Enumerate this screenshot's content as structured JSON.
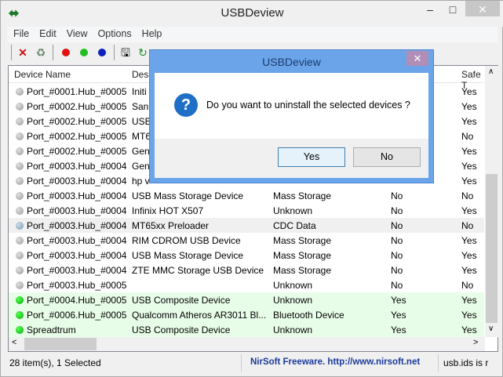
{
  "window": {
    "title": "USBDeview",
    "minimize": "–",
    "maximize": "□",
    "close": "✕"
  },
  "menu": [
    "File",
    "Edit",
    "View",
    "Options",
    "Help"
  ],
  "columns": [
    "Device Name",
    "Desc",
    "",
    "",
    "Safe T"
  ],
  "rows": [
    {
      "name": "Port_#0001.Hub_#0005",
      "desc": "Initi",
      "type": "",
      "connected": "",
      "safe": "Yes",
      "state": "off"
    },
    {
      "name": "Port_#0002.Hub_#0005",
      "desc": "SanD",
      "type": "",
      "connected": "",
      "safe": "Yes",
      "state": "off"
    },
    {
      "name": "Port_#0002.Hub_#0005",
      "desc": "USB",
      "type": "",
      "connected": "",
      "safe": "Yes",
      "state": "off"
    },
    {
      "name": "Port_#0002.Hub_#0005",
      "desc": "MT6",
      "type": "",
      "connected": "",
      "safe": "No",
      "state": "off"
    },
    {
      "name": "Port_#0002.Hub_#0005",
      "desc": "Gen",
      "type": "",
      "connected": "",
      "safe": "Yes",
      "state": "off"
    },
    {
      "name": "Port_#0003.Hub_#0004",
      "desc": "Gen",
      "type": "",
      "connected": "",
      "safe": "Yes",
      "state": "off"
    },
    {
      "name": "Port_#0003.Hub_#0004",
      "desc": "hp v",
      "type": "",
      "connected": "",
      "safe": "Yes",
      "state": "off"
    },
    {
      "name": "Port_#0003.Hub_#0004",
      "desc": "USB Mass Storage Device",
      "type": "Mass Storage",
      "connected": "No",
      "safe": "No",
      "state": "off"
    },
    {
      "name": "Port_#0003.Hub_#0004",
      "desc": "Infinix HOT X507",
      "type": "Unknown",
      "connected": "No",
      "safe": "Yes",
      "state": "off"
    },
    {
      "name": "Port_#0003.Hub_#0004",
      "desc": "MT65xx Preloader",
      "type": "CDC Data",
      "connected": "No",
      "safe": "No",
      "state": "selected"
    },
    {
      "name": "Port_#0003.Hub_#0004",
      "desc": "RIM CDROM USB Device",
      "type": "Mass Storage",
      "connected": "No",
      "safe": "Yes",
      "state": "off"
    },
    {
      "name": "Port_#0003.Hub_#0004",
      "desc": "USB Mass Storage Device",
      "type": "Mass Storage",
      "connected": "No",
      "safe": "Yes",
      "state": "off"
    },
    {
      "name": "Port_#0003.Hub_#0004",
      "desc": "ZTE MMC Storage USB Device",
      "type": "Mass Storage",
      "connected": "No",
      "safe": "Yes",
      "state": "off"
    },
    {
      "name": "Port_#0003.Hub_#0005",
      "desc": "",
      "type": "Unknown",
      "connected": "No",
      "safe": "No",
      "state": "off"
    },
    {
      "name": "Port_#0004.Hub_#0005",
      "desc": "USB Composite Device",
      "type": "Unknown",
      "connected": "Yes",
      "safe": "Yes",
      "state": "connected"
    },
    {
      "name": "Port_#0006.Hub_#0005",
      "desc": "Qualcomm Atheros AR3011 Bl...",
      "type": "Bluetooth Device",
      "connected": "Yes",
      "safe": "Yes",
      "state": "connected"
    },
    {
      "name": "Spreadtrum",
      "desc": "USB Composite Device",
      "type": "Unknown",
      "connected": "Yes",
      "safe": "Yes",
      "state": "connected"
    }
  ],
  "status": {
    "count": "28 item(s), 1 Selected",
    "nirsoft": "NirSoft Freeware.  http://www.nirsoft.net",
    "usbids": "usb.ids is r"
  },
  "dialog": {
    "title": "USBDeview",
    "close": "✕",
    "message": "Do you want to uninstall the selected devices ?",
    "yes": "Yes",
    "no": "No",
    "icon": "?"
  },
  "colors": {
    "dialog_title": "#6ba4e8",
    "connected_row": "#e8fde8",
    "nirsoft_link": "#1a3a9a"
  }
}
